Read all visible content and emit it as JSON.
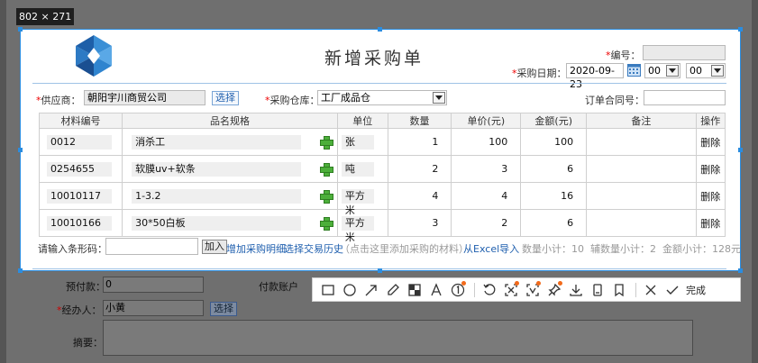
{
  "screenshot": {
    "size_label": "802 × 271"
  },
  "form": {
    "title": "新增采购单",
    "number_label": "编号：",
    "number_value": "",
    "purchase_date_label": "采购日期：",
    "purchase_date_value": "2020-09-23",
    "hour_value": "00",
    "minute_value": "00",
    "supplier_label": "供应商：",
    "supplier_value": "朝阳宇川商贸公司",
    "select_label": "选择",
    "warehouse_label": "采购仓库：",
    "warehouse_value": "工厂成品仓",
    "order_contract_label": "订单合同号：",
    "order_contract_value": ""
  },
  "table": {
    "headers": [
      "材料编号",
      "品名规格",
      "单位",
      "数量",
      "单价(元)",
      "金额(元)",
      "备注",
      "操作"
    ],
    "rows": [
      {
        "code": "0012",
        "name": "消杀工",
        "unit": "张",
        "qty": "1",
        "price": "100",
        "amount": "100",
        "note": "",
        "action": "删除"
      },
      {
        "code": "0254655",
        "name": "软膜uv+软条",
        "unit": "吨",
        "qty": "2",
        "price": "3",
        "amount": "6",
        "note": "",
        "action": "删除"
      },
      {
        "code": "10010117",
        "name": "1-3.2",
        "unit": "平方米",
        "qty": "4",
        "price": "4",
        "amount": "16",
        "note": "",
        "action": "删除"
      },
      {
        "code": "10010166",
        "name": "30*50白板",
        "unit": "平方米",
        "qty": "3",
        "price": "2",
        "amount": "6",
        "note": "",
        "action": "删除"
      }
    ]
  },
  "footer": {
    "barcode_label": "请输入条形码：",
    "barcode_value": "",
    "add_label": "加入",
    "add_detail_link": "增加采购明细",
    "select_history_link": "选择交易历史",
    "hint_text": "（点击这里添加采购的材料）",
    "excel_link": "从Excel导入",
    "summary_text": "数量小计：10  辅数量小计：2  金额小计：128元"
  },
  "background_form": {
    "prepaid_label": "预付款：",
    "prepaid_value": "0",
    "payment_account_label": "付款账户",
    "handler_label": "经办人：",
    "handler_value": "小黄",
    "select_label": "选择",
    "summary_label": "摘要："
  },
  "toolbar": {
    "done_label": "完成",
    "icons": [
      "rectangle-icon",
      "ellipse-icon",
      "arrow-icon",
      "pen-icon",
      "mosaic-icon",
      "text-icon",
      "number-marker-icon",
      "undo-icon",
      "ocr-icon",
      "translate-icon",
      "pin-icon",
      "save-icon",
      "long-screenshot-icon",
      "bookmark-icon",
      "cancel-icon",
      "confirm-icon"
    ]
  },
  "colors": {
    "selection_border": "#2b8de0",
    "link": "#1f5fae",
    "required": "#e00000",
    "toolbar_badge": "#f26a1b"
  }
}
